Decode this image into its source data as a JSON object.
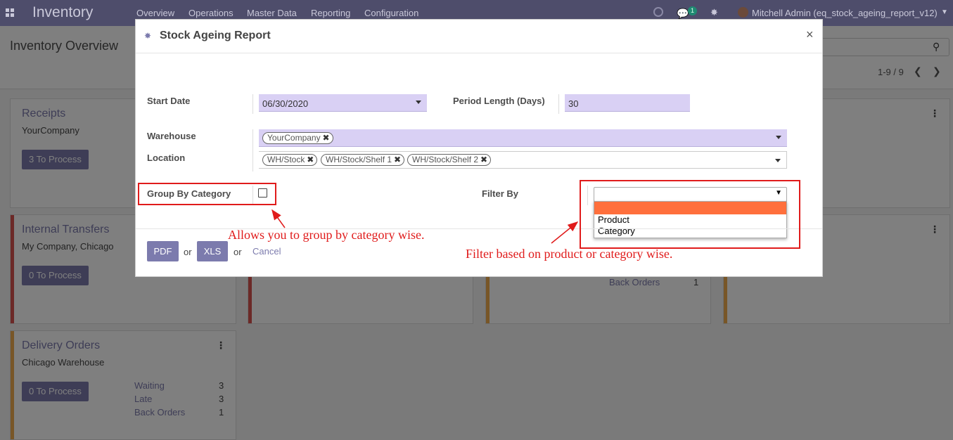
{
  "navbar": {
    "brand": "Inventory",
    "menu": [
      "Overview",
      "Operations",
      "Master Data",
      "Reporting",
      "Configuration"
    ],
    "chat_count": "1",
    "user": "Mitchell Admin (eq_stock_ageing_report_v12)"
  },
  "control_panel": {
    "title": "Inventory Overview",
    "pager": "1-9 / 9"
  },
  "cards": [
    {
      "title": "Receipts",
      "subtitle": "YourCompany",
      "button": "3 To Process"
    },
    {
      "title": "Internal Transfers",
      "subtitle": "My Company, Chicago",
      "button": "0 To Process"
    },
    {
      "title": "Delivery Orders",
      "subtitle": "Chicago Warehouse",
      "button": "0 To Process",
      "stats": [
        {
          "label": "Waiting",
          "value": "3"
        },
        {
          "label": "Late",
          "value": "3"
        },
        {
          "label": "Back Orders",
          "value": "1"
        }
      ]
    },
    {
      "stats": [
        {
          "label": "Back Orders",
          "value": "1"
        }
      ]
    }
  ],
  "modal": {
    "title": "Stock Ageing Report",
    "fields": {
      "start_date_label": "Start Date",
      "start_date_value": "06/30/2020",
      "period_length_label": "Period Length (Days)",
      "period_length_value": "30",
      "warehouse_label": "Warehouse",
      "warehouse_tags": [
        "YourCompany"
      ],
      "location_label": "Location",
      "location_tags": [
        "WH/Stock",
        "WH/Stock/Shelf 1",
        "WH/Stock/Shelf 2"
      ],
      "group_by_label": "Group By Category",
      "filter_by_label": "Filter By",
      "filter_by_options": [
        "",
        "Product",
        "Category"
      ]
    },
    "footer": {
      "pdf_label": "PDF",
      "xls_label": "XLS",
      "or_text": "or",
      "cancel_label": "Cancel"
    }
  },
  "annotations": {
    "group_note": "Allows you to group by category wise.",
    "filter_note": "Filter based on product or category wise."
  },
  "colors": {
    "brand": "#7c7bad",
    "required_field": "#d9d0f4",
    "highlight_option": "#ff6f3c",
    "annotation_red": "#e01b1b"
  }
}
